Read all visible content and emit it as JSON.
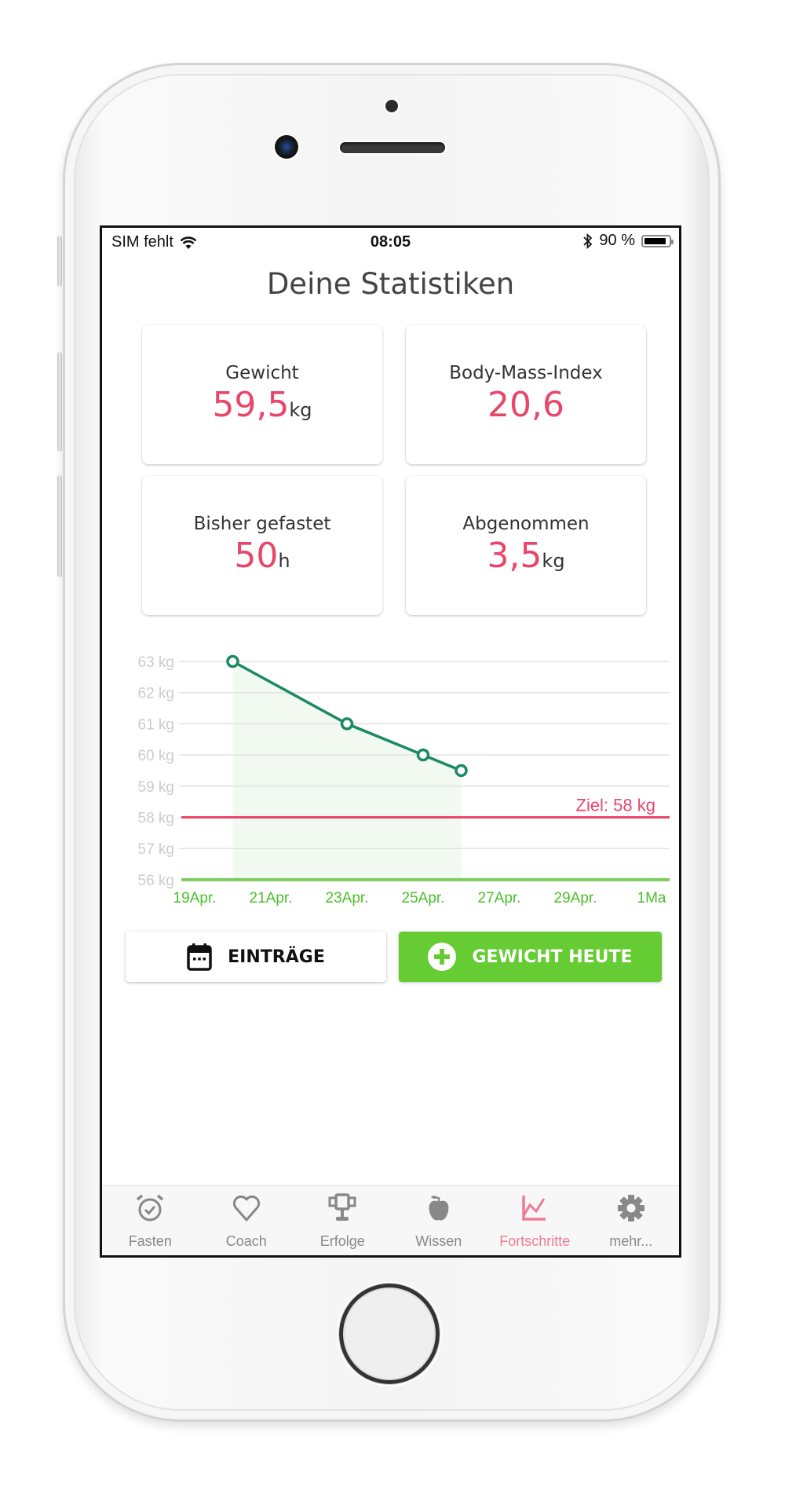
{
  "statusbar": {
    "carrier": "SIM fehlt",
    "time": "08:05",
    "battery": "90 %",
    "battery_level": 0.9
  },
  "header": {
    "title": "Deine Statistiken"
  },
  "cards": [
    {
      "label": "Gewicht",
      "value": "59,5",
      "unit": "kg"
    },
    {
      "label": "Body-Mass-Index",
      "value": "20,6",
      "unit": ""
    },
    {
      "label": "Bisher gefastet",
      "value": "50",
      "unit": "h"
    },
    {
      "label": "Abgenommen",
      "value": "3,5",
      "unit": "kg"
    }
  ],
  "chart_data": {
    "type": "line",
    "title": "",
    "xlabel": "",
    "ylabel": "",
    "x_tick_labels": [
      "19Apr.",
      "21Apr.",
      "23Apr.",
      "25Apr.",
      "27Apr.",
      "29Apr.",
      "1Ma"
    ],
    "x_tick_days": [
      0,
      2,
      4,
      6,
      8,
      10,
      12
    ],
    "y_tick_labels": [
      "63 kg",
      "62 kg",
      "61 kg",
      "60 kg",
      "59 kg",
      "58 kg",
      "57 kg",
      "56 kg"
    ],
    "y_ticks": [
      63,
      62,
      61,
      60,
      59,
      58,
      57,
      56
    ],
    "ylim": [
      56,
      63
    ],
    "xlim_days": [
      0,
      12
    ],
    "x_origin": "19 Apr",
    "grid": true,
    "series": [
      {
        "name": "Gewicht",
        "x_days": [
          1,
          4,
          6,
          7
        ],
        "x_labels": [
          "20 Apr",
          "23 Apr",
          "25 Apr",
          "26 Apr"
        ],
        "values": [
          63,
          61,
          60,
          59.5
        ],
        "color": "#1a8a64",
        "fill": "#f1f9f1"
      }
    ],
    "goal": {
      "label": "Ziel: 58 kg",
      "value": 58,
      "color": "#e8466b"
    },
    "axis_color": "#7ccc5c",
    "x_label_color": "#4cc02c",
    "y_label_color": "#cccccc"
  },
  "buttons": {
    "entries": {
      "label": "EINTRÄGE",
      "icon": "calendar-icon"
    },
    "weight_today": {
      "label": "GEWICHT HEUTE",
      "icon": "plus-circle-icon"
    }
  },
  "colors": {
    "accent": "#e8466b",
    "green": "#66cc33",
    "tab_active": "#f07a95",
    "tab_inactive": "#888888"
  },
  "tabs": [
    {
      "label": "Fasten",
      "icon": "alarm-clock-icon",
      "active": false
    },
    {
      "label": "Coach",
      "icon": "heart-icon",
      "active": false
    },
    {
      "label": "Erfolge",
      "icon": "trophy-icon",
      "active": false
    },
    {
      "label": "Wissen",
      "icon": "apple-icon",
      "active": false
    },
    {
      "label": "Fortschritte",
      "icon": "chart-icon",
      "active": true
    },
    {
      "label": "mehr...",
      "icon": "gear-icon",
      "active": false
    }
  ]
}
